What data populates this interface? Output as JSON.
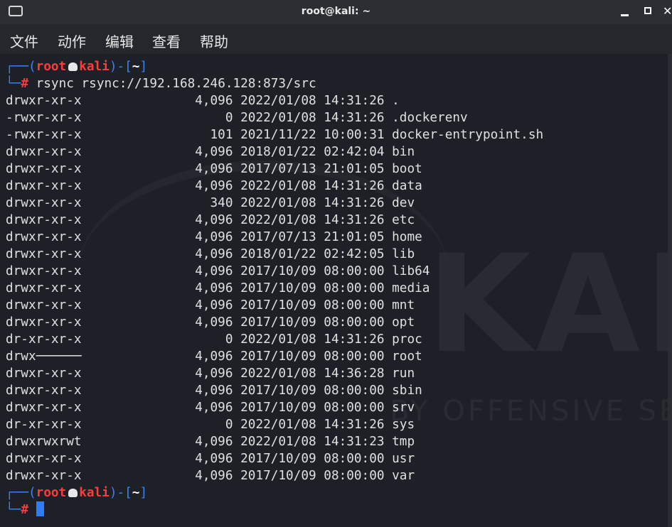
{
  "window": {
    "title": "root@kali: ~"
  },
  "menu": [
    {
      "label": "文件"
    },
    {
      "label": "动作"
    },
    {
      "label": "编辑"
    },
    {
      "label": "查看"
    },
    {
      "label": "帮助"
    }
  ],
  "prompt": {
    "user": "root",
    "host": "kali",
    "dir": "~",
    "symbol": "#",
    "open": "┌──(",
    "mid": ")-[",
    "close": "]",
    "corner": "└─"
  },
  "command": "rsync rsync://192.168.246.128:873/src",
  "listing": [
    {
      "perm": "drwxr-xr-x",
      "size": "4,096",
      "date": "2022/01/08",
      "time": "14:31:26",
      "name": "."
    },
    {
      "perm": "-rwxr-xr-x",
      "size": "0",
      "date": "2022/01/08",
      "time": "14:31:26",
      "name": ".dockerenv"
    },
    {
      "perm": "-rwxr-xr-x",
      "size": "101",
      "date": "2021/11/22",
      "time": "10:00:31",
      "name": "docker-entrypoint.sh"
    },
    {
      "perm": "drwxr-xr-x",
      "size": "4,096",
      "date": "2018/01/22",
      "time": "02:42:04",
      "name": "bin"
    },
    {
      "perm": "drwxr-xr-x",
      "size": "4,096",
      "date": "2017/07/13",
      "time": "21:01:05",
      "name": "boot"
    },
    {
      "perm": "drwxr-xr-x",
      "size": "4,096",
      "date": "2022/01/08",
      "time": "14:31:26",
      "name": "data"
    },
    {
      "perm": "drwxr-xr-x",
      "size": "340",
      "date": "2022/01/08",
      "time": "14:31:26",
      "name": "dev"
    },
    {
      "perm": "drwxr-xr-x",
      "size": "4,096",
      "date": "2022/01/08",
      "time": "14:31:26",
      "name": "etc"
    },
    {
      "perm": "drwxr-xr-x",
      "size": "4,096",
      "date": "2017/07/13",
      "time": "21:01:05",
      "name": "home"
    },
    {
      "perm": "drwxr-xr-x",
      "size": "4,096",
      "date": "2018/01/22",
      "time": "02:42:05",
      "name": "lib"
    },
    {
      "perm": "drwxr-xr-x",
      "size": "4,096",
      "date": "2017/10/09",
      "time": "08:00:00",
      "name": "lib64"
    },
    {
      "perm": "drwxr-xr-x",
      "size": "4,096",
      "date": "2017/10/09",
      "time": "08:00:00",
      "name": "media"
    },
    {
      "perm": "drwxr-xr-x",
      "size": "4,096",
      "date": "2017/10/09",
      "time": "08:00:00",
      "name": "mnt"
    },
    {
      "perm": "drwxr-xr-x",
      "size": "4,096",
      "date": "2017/10/09",
      "time": "08:00:00",
      "name": "opt"
    },
    {
      "perm": "dr-xr-xr-x",
      "size": "0",
      "date": "2022/01/08",
      "time": "14:31:26",
      "name": "proc"
    },
    {
      "perm": "drwx──────",
      "size": "4,096",
      "date": "2017/10/09",
      "time": "08:00:00",
      "name": "root"
    },
    {
      "perm": "drwxr-xr-x",
      "size": "4,096",
      "date": "2022/01/08",
      "time": "14:36:28",
      "name": "run"
    },
    {
      "perm": "drwxr-xr-x",
      "size": "4,096",
      "date": "2017/10/09",
      "time": "08:00:00",
      "name": "sbin"
    },
    {
      "perm": "drwxr-xr-x",
      "size": "4,096",
      "date": "2017/10/09",
      "time": "08:00:00",
      "name": "srv"
    },
    {
      "perm": "dr-xr-xr-x",
      "size": "0",
      "date": "2022/01/08",
      "time": "14:31:26",
      "name": "sys"
    },
    {
      "perm": "drwxrwxrwt",
      "size": "4,096",
      "date": "2022/01/08",
      "time": "14:31:23",
      "name": "tmp"
    },
    {
      "perm": "drwxr-xr-x",
      "size": "4,096",
      "date": "2017/10/09",
      "time": "08:00:00",
      "name": "usr"
    },
    {
      "perm": "drwxr-xr-x",
      "size": "4,096",
      "date": "2017/10/09",
      "time": "08:00:00",
      "name": "var"
    }
  ],
  "watermark": {
    "big": "KALI",
    "small": "BY OFFENSIVE SECURITY"
  },
  "colors": {
    "background": "#1d2026",
    "prompt_frame": "#3b82f6",
    "prompt_user": "#ff3b3b",
    "cursor": "#2f7df6"
  }
}
